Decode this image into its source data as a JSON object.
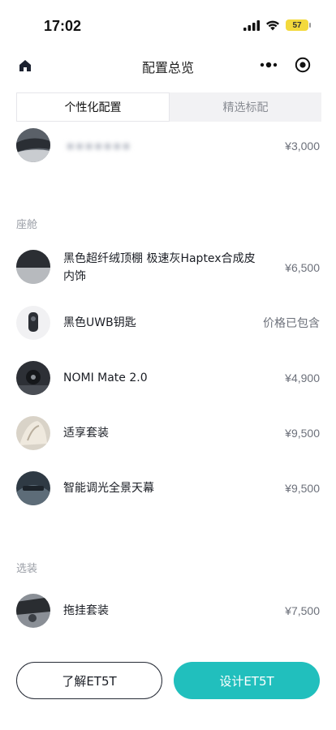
{
  "status": {
    "time": "17:02",
    "battery": "57"
  },
  "nav": {
    "title": "配置总览"
  },
  "tabs": [
    {
      "label": "个性化配置"
    },
    {
      "label": "精选标配"
    }
  ],
  "top_item": {
    "name": "▪▪▪▪▪▪▪",
    "price": "¥3,000"
  },
  "sections": [
    {
      "title": "座舱",
      "items": [
        {
          "name": "黑色超纤绒顶棚 极速灰Haptex合成皮内饰",
          "price": "¥6,500"
        },
        {
          "name": "黑色UWB钥匙",
          "price": "价格已包含"
        },
        {
          "name": "NOMI Mate 2.0",
          "price": "¥4,900"
        },
        {
          "name": "适享套装",
          "price": "¥9,500"
        },
        {
          "name": "智能调光全景天幕",
          "price": "¥9,500"
        }
      ]
    },
    {
      "title": "选装",
      "items": [
        {
          "name": "拖挂套装",
          "price": "¥7,500"
        }
      ]
    }
  ],
  "buttons": {
    "learn": "了解ET5T",
    "design": "设计ET5T"
  },
  "colors": {
    "accent": "#21bfbd",
    "dark": "#262b36"
  }
}
